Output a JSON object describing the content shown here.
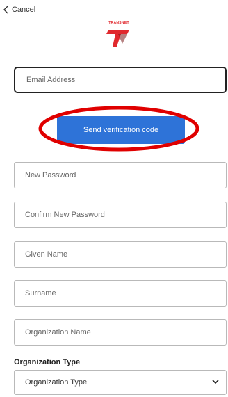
{
  "nav": {
    "cancel_label": "Cancel",
    "back_icon": "chevron-left-icon"
  },
  "logo": {
    "text": "TRANSNET",
    "brand_color": "#e0292e"
  },
  "form": {
    "email_placeholder": "Email Address",
    "send_code_label": "Send verification code",
    "new_password_placeholder": "New Password",
    "confirm_password_placeholder": "Confirm New Password",
    "given_name_placeholder": "Given Name",
    "surname_placeholder": "Surname",
    "organization_name_placeholder": "Organization Name",
    "organization_type_label": "Organization Type",
    "organization_type_selected": "Organization Type"
  },
  "colors": {
    "primary_button": "#2e73d8",
    "highlight_ring": "#e00000"
  }
}
